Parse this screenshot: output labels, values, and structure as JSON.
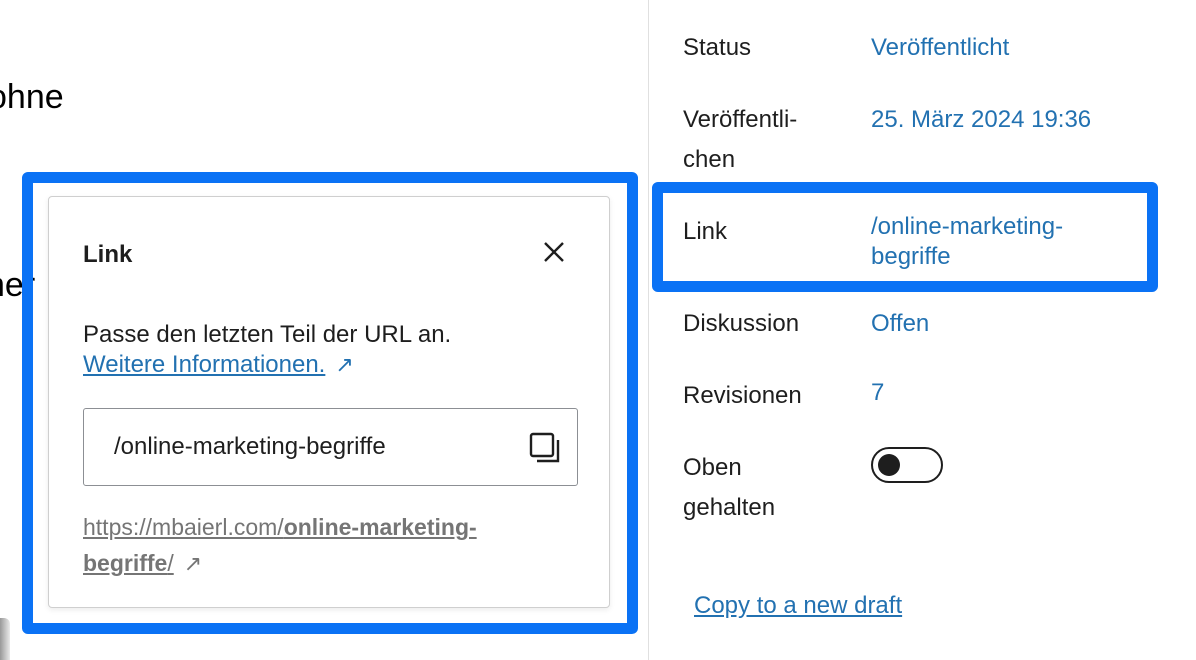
{
  "editor": {
    "fragment_1": "ohne",
    "fragment_2": "her"
  },
  "popover": {
    "title": "Link",
    "description": "Passe den letzten Teil der URL an.",
    "more_link": "Weitere Informationen.",
    "slug_value": "/online-marketing-begriffe",
    "full_url_base": "https://mbaierl.com/",
    "full_url_slug_1": "online-marketing-",
    "full_url_slug_2": "begriffe",
    "full_url_end": "/",
    "external_glyph": "↗"
  },
  "sidebar": {
    "status_label": "Status",
    "status_value": "Veröffentlicht",
    "publish_label_1": "Veröffentli-",
    "publish_label_2": "chen",
    "publish_value": "25. März 2024 19:36",
    "link_label": "Link",
    "link_value_1": "/online-marketing-",
    "link_value_2": "begriffe",
    "discussion_label": "Diskussion",
    "discussion_value": "Offen",
    "revisions_label": "Revisionen",
    "revisions_value": "7",
    "sticky_label_1": "Oben",
    "sticky_label_2": "gehalten",
    "sticky_on": false,
    "copy_draft": "Copy to a new draft"
  },
  "colors": {
    "highlight": "#0a72f5",
    "link": "#2271b1"
  }
}
